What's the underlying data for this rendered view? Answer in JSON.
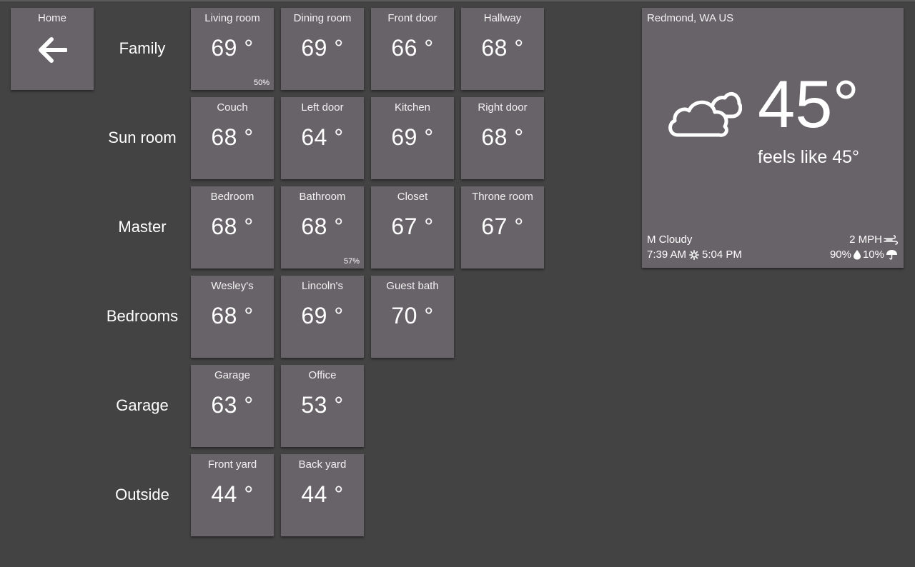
{
  "home": {
    "label": "Home",
    "icon": "back-arrow-icon"
  },
  "groups": [
    {
      "label": "Family",
      "rooms": [
        {
          "name": "Living room",
          "temp": "69 °",
          "humidity": "50%"
        },
        {
          "name": "Dining room",
          "temp": "69 °"
        },
        {
          "name": "Front door",
          "temp": "66 °"
        },
        {
          "name": "Hallway",
          "temp": "68 °"
        }
      ]
    },
    {
      "label": "Sun room",
      "rooms": [
        {
          "name": "Couch",
          "temp": "68 °"
        },
        {
          "name": "Left door",
          "temp": "64 °"
        },
        {
          "name": "Kitchen",
          "temp": "69 °"
        },
        {
          "name": "Right door",
          "temp": "68 °"
        }
      ]
    },
    {
      "label": "Master",
      "rooms": [
        {
          "name": "Bedroom",
          "temp": "68 °"
        },
        {
          "name": "Bathroom",
          "temp": "68 °",
          "humidity": "57%"
        },
        {
          "name": "Closet",
          "temp": "67 °"
        },
        {
          "name": "Throne room",
          "temp": "67 °"
        }
      ]
    },
    {
      "label": "Bedrooms",
      "rooms": [
        {
          "name": "Wesley's",
          "temp": "68 °"
        },
        {
          "name": "Lincoln's",
          "temp": "69 °"
        },
        {
          "name": "Guest bath",
          "temp": "70 °"
        }
      ]
    },
    {
      "label": "Garage",
      "rooms": [
        {
          "name": "Garage",
          "temp": "63 °"
        },
        {
          "name": "Office",
          "temp": "53 °"
        }
      ]
    },
    {
      "label": "Outside",
      "rooms": [
        {
          "name": "Front yard",
          "temp": "44 °"
        },
        {
          "name": "Back yard",
          "temp": "44 °"
        }
      ]
    }
  ],
  "weather": {
    "location": "Redmond, WA US",
    "temp": "45°",
    "feels_like": "feels like 45°",
    "condition": "M Cloudy",
    "condition_icon": "cloudy-icon",
    "sunrise": "7:39 AM",
    "sunset": "5:04 PM",
    "wind": "2 MPH",
    "humidity": "90%",
    "precip_chance": "10%"
  },
  "colors": {
    "background": "#434343",
    "tile": "#686368",
    "text": "#ffffff"
  }
}
